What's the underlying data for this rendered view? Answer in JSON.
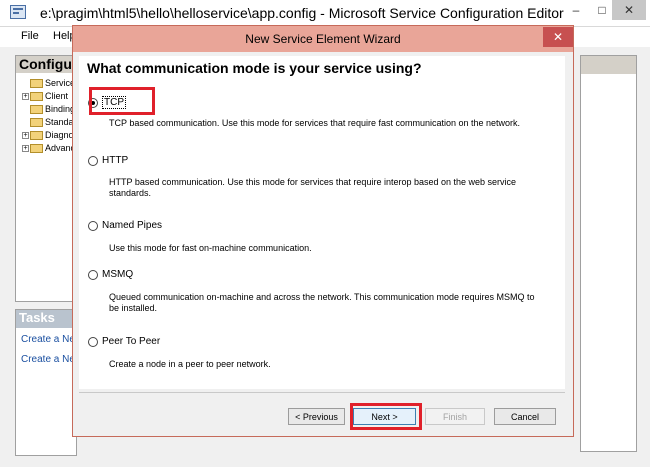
{
  "main_window": {
    "title": "e:\\pragim\\html5\\hello\\helloservice\\app.config - Microsoft Service Configuration Editor",
    "controls": {
      "minimize": "–",
      "maximize": "□",
      "close": "✕"
    },
    "menu": {
      "file": "File",
      "help": "Help"
    },
    "config_panel": {
      "header": "Configuration",
      "tree_items": [
        {
          "label": "Services",
          "expandable": false
        },
        {
          "label": "Client",
          "expandable": true
        },
        {
          "label": "Bindings",
          "expandable": false
        },
        {
          "label": "Standard Endpoints",
          "expandable": false
        },
        {
          "label": "Diagnostics",
          "expandable": true
        },
        {
          "label": "Advanced",
          "expandable": true
        }
      ]
    },
    "tasks_panel": {
      "header": "Tasks",
      "links": [
        "Create a New Service...",
        "Create a New Client..."
      ]
    }
  },
  "dialog": {
    "title": "New Service Element Wizard",
    "close_glyph": "✕",
    "question": "What communication mode is your service using?",
    "options": [
      {
        "label": "TCP",
        "checked": true,
        "description": "TCP based communication. Use this mode for services that require fast communication on the network."
      },
      {
        "label": "HTTP",
        "checked": false,
        "description": "HTTP based communication. Use this mode for services that require interop based on the web service standards."
      },
      {
        "label": "Named Pipes",
        "checked": false,
        "description": "Use this mode for fast on-machine communication."
      },
      {
        "label": "MSMQ",
        "checked": false,
        "description": "Queued communication on-machine and across the network. This communication mode requires MSMQ to be installed."
      },
      {
        "label": "Peer To Peer",
        "checked": false,
        "description": "Create a node in a peer to peer network."
      }
    ],
    "buttons": {
      "previous": "< Previous",
      "next": "Next >",
      "finish": "Finish",
      "cancel": "Cancel"
    }
  },
  "colors": {
    "dialog_title_bar": "#e9a598",
    "dialog_close": "#c75050",
    "highlight_box": "#e0202a",
    "tasks_header": "#b9c3ce"
  }
}
